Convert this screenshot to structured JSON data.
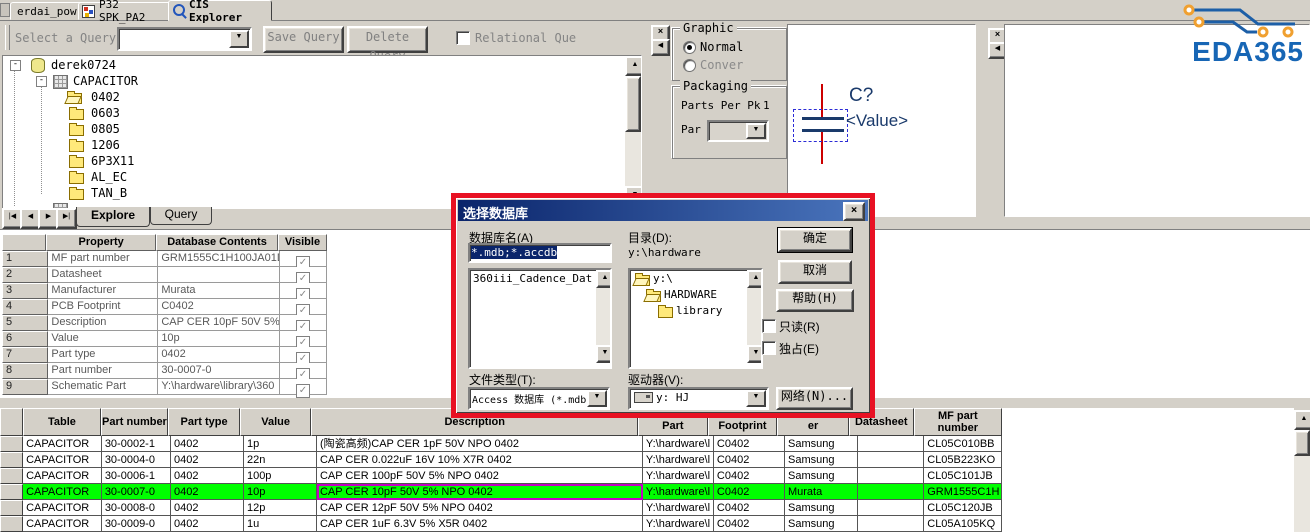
{
  "tabs": {
    "items": [
      {
        "label": "erdai_pow..."
      },
      {
        "label": "P32 SPK_PA2"
      },
      {
        "label": "CIS Explorer"
      }
    ]
  },
  "toolbar": {
    "select_query_label": "Select a Query:",
    "save_query": "Save Query",
    "delete_query": "Delete Query",
    "relational": "Relational Que"
  },
  "tree": {
    "root": "derek0724",
    "table": "CAPACITOR",
    "folders": [
      "0402",
      "0603",
      "0805",
      "1206",
      "6P3X11",
      "AL_EC",
      "TAN_B"
    ]
  },
  "pane_tabs": {
    "explore": "Explore",
    "query": "Query"
  },
  "graphic": {
    "legend": "Graphic",
    "options": [
      "Normal",
      "Conver"
    ]
  },
  "packaging": {
    "legend": "Packaging",
    "parts_per_label": "Parts Per Pk",
    "parts_per_value": "1",
    "part_label": "Par"
  },
  "symbol": {
    "designator": "C?",
    "value": "<Value>"
  },
  "logo": {
    "text": "EDA365"
  },
  "prop_table": {
    "col_property": "Property",
    "col_contents": "Database Contents",
    "col_visible": "Visible",
    "rows": [
      [
        "1",
        "MF part number",
        "GRM1555C1H100JA01D"
      ],
      [
        "2",
        "Datasheet",
        ""
      ],
      [
        "3",
        "Manufacturer",
        "Murata"
      ],
      [
        "4",
        "PCB Footprint",
        "C0402"
      ],
      [
        "5",
        "Description",
        "CAP CER 10pF 50V 5%"
      ],
      [
        "6",
        "Value",
        "10p"
      ],
      [
        "7",
        "Part type",
        "0402"
      ],
      [
        "8",
        "Part number",
        "30-0007-0"
      ],
      [
        "9",
        "Schematic Part",
        "Y:\\hardware\\library\\360"
      ]
    ]
  },
  "dialog": {
    "title": "选择数据库",
    "db_name_label": "数据库名(A)",
    "db_name_value": "*.mdb;*.accdb",
    "db_list_item": "360iii_Cadence_Dat",
    "dir_label": "目录(D):",
    "dir_value": "y:\\hardware",
    "dir_items": [
      "y:\\",
      "HARDWARE",
      "library"
    ],
    "file_type_label": "文件类型(T):",
    "file_type_value": "Access 数据库 (*.mdb",
    "drive_label": "驱动器(V):",
    "drive_value": "y: HJ",
    "ok": "确定",
    "cancel": "取消",
    "help": "帮助(H)",
    "readonly": "只读(R)",
    "exclusive": "独占(E)",
    "network": "网络(N)..."
  },
  "parts": {
    "headers": [
      "Table",
      "Part number",
      "Part type",
      "Value",
      "Description",
      "Part",
      "Footprint",
      "er",
      "Datasheet",
      "MF part number"
    ],
    "rows": [
      [
        "CAPACITOR",
        "30-0002-1",
        "0402",
        "1p",
        "(陶瓷高频)CAP CER 1pF 50V NPO 0402",
        "Y:\\hardware\\l",
        "C0402",
        "Samsung",
        "",
        "CL05C010BB"
      ],
      [
        "CAPACITOR",
        "30-0004-0",
        "0402",
        "22n",
        "CAP CER 0.022uF 16V 10% X7R 0402",
        "Y:\\hardware\\l",
        "C0402",
        "Samsung",
        "",
        "CL05B223KO"
      ],
      [
        "CAPACITOR",
        "30-0006-1",
        "0402",
        "100p",
        "CAP CER 100pF 50V 5% NPO 0402",
        "Y:\\hardware\\l",
        "C0402",
        "Samsung",
        "",
        "CL05C101JB"
      ],
      [
        "CAPACITOR",
        "30-0007-0",
        "0402",
        "10p",
        "CAP CER 10pF 50V 5% NPO 0402",
        "Y:\\hardware\\l",
        "C0402",
        "Murata",
        "",
        "GRM1555C1H"
      ],
      [
        "CAPACITOR",
        "30-0008-0",
        "0402",
        "12p",
        "CAP CER 12pF 50V 5% NPO 0402",
        "Y:\\hardware\\l",
        "C0402",
        "Samsung",
        "",
        "CL05C120JB"
      ],
      [
        "CAPACITOR",
        "30-0009-0",
        "0402",
        "1u",
        "CAP CER 1uF 6.3V 5% X5R 0402",
        "Y:\\hardware\\l",
        "C0402",
        "Samsung",
        "",
        "CL05A105KQ"
      ]
    ],
    "highlighted_row_index": 3
  },
  "colors": {
    "highlight_green": "#00ff00",
    "annotation_red": "#e81123",
    "title_blue": "#0a246a",
    "logo_blue": "#1766b5",
    "symbol_navy": "#1a3a6b",
    "pin_red": "#cc0000"
  }
}
